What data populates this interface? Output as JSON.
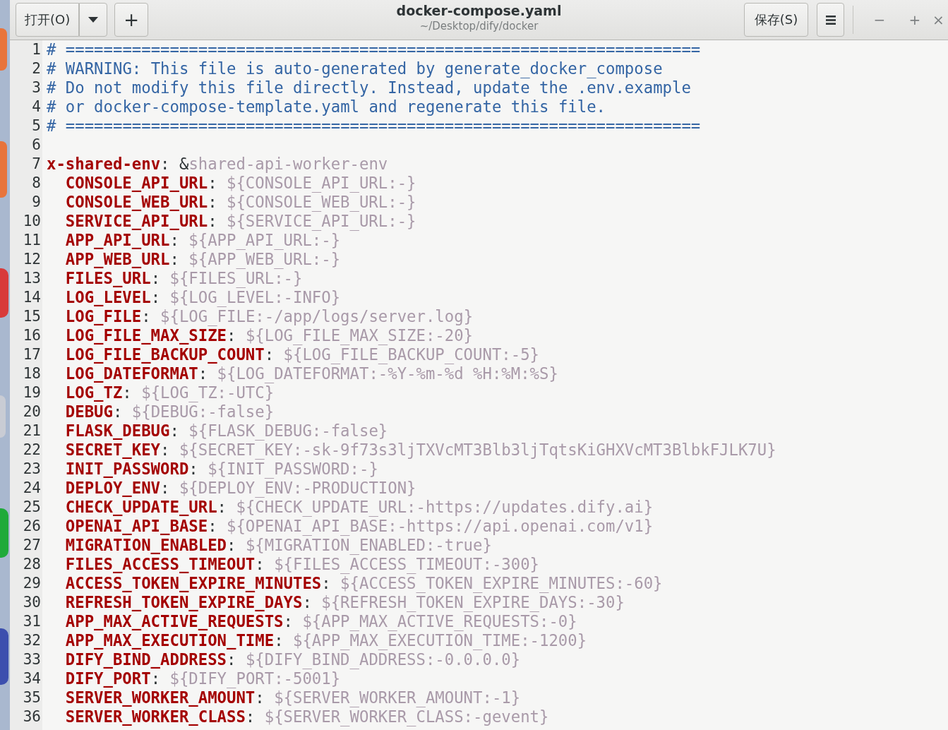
{
  "window": {
    "title": "docker-compose.yaml",
    "subtitle": "~/Desktop/dify/docker",
    "open_button": "打开(O)",
    "new_tab_button": "+",
    "save_button": "保存(S)",
    "controls": [
      "−",
      "+",
      "×"
    ]
  },
  "editor": {
    "lines": [
      {
        "number": "1",
        "indented": false,
        "segments": [
          {
            "kind": "comment",
            "text": "# ==================================================================="
          }
        ]
      },
      {
        "number": "2",
        "indented": false,
        "segments": [
          {
            "kind": "comment",
            "text": "# WARNING: This file is auto-generated by generate_docker_compose"
          }
        ]
      },
      {
        "number": "3",
        "indented": false,
        "segments": [
          {
            "kind": "comment",
            "text": "# Do not modify this file directly. Instead, update the .env.example"
          }
        ]
      },
      {
        "number": "4",
        "indented": false,
        "segments": [
          {
            "kind": "comment",
            "text": "# or docker-compose-template.yaml and regenerate this file."
          }
        ]
      },
      {
        "number": "5",
        "indented": false,
        "segments": [
          {
            "kind": "comment",
            "text": "# ==================================================================="
          }
        ]
      },
      {
        "number": "6"
      },
      {
        "number": "7",
        "indented": false,
        "segments": [
          {
            "kind": "key",
            "text": "x-shared-env"
          },
          {
            "kind": "punct",
            "text": ": &"
          },
          {
            "kind": "value",
            "text": "shared-api-worker-env"
          }
        ]
      },
      {
        "number": "8",
        "indented": true,
        "segments": [
          {
            "kind": "key",
            "text": "CONSOLE_API_URL"
          },
          {
            "kind": "punct",
            "text": ": "
          },
          {
            "kind": "value",
            "text": "${CONSOLE_API_URL:-}"
          }
        ]
      },
      {
        "number": "9",
        "indented": true,
        "segments": [
          {
            "kind": "key",
            "text": "CONSOLE_WEB_URL"
          },
          {
            "kind": "punct",
            "text": ": "
          },
          {
            "kind": "value",
            "text": "${CONSOLE_WEB_URL:-}"
          }
        ]
      },
      {
        "number": "10",
        "indented": true,
        "segments": [
          {
            "kind": "key",
            "text": "SERVICE_API_URL"
          },
          {
            "kind": "punct",
            "text": ": "
          },
          {
            "kind": "value",
            "text": "${SERVICE_API_URL:-}"
          }
        ]
      },
      {
        "number": "11",
        "indented": true,
        "segments": [
          {
            "kind": "key",
            "text": "APP_API_URL"
          },
          {
            "kind": "punct",
            "text": ": "
          },
          {
            "kind": "value",
            "text": "${APP_API_URL:-}"
          }
        ]
      },
      {
        "number": "12",
        "indented": true,
        "segments": [
          {
            "kind": "key",
            "text": "APP_WEB_URL"
          },
          {
            "kind": "punct",
            "text": ": "
          },
          {
            "kind": "value",
            "text": "${APP_WEB_URL:-}"
          }
        ]
      },
      {
        "number": "13",
        "indented": true,
        "segments": [
          {
            "kind": "key",
            "text": "FILES_URL"
          },
          {
            "kind": "punct",
            "text": ": "
          },
          {
            "kind": "value",
            "text": "${FILES_URL:-}"
          }
        ]
      },
      {
        "number": "14",
        "indented": true,
        "segments": [
          {
            "kind": "key",
            "text": "LOG_LEVEL"
          },
          {
            "kind": "punct",
            "text": ": "
          },
          {
            "kind": "value",
            "text": "${LOG_LEVEL:-INFO}"
          }
        ]
      },
      {
        "number": "15",
        "indented": true,
        "segments": [
          {
            "kind": "key",
            "text": "LOG_FILE"
          },
          {
            "kind": "punct",
            "text": ": "
          },
          {
            "kind": "value",
            "text": "${LOG_FILE:-/app/logs/server.log}"
          }
        ]
      },
      {
        "number": "16",
        "indented": true,
        "segments": [
          {
            "kind": "key",
            "text": "LOG_FILE_MAX_SIZE"
          },
          {
            "kind": "punct",
            "text": ": "
          },
          {
            "kind": "value",
            "text": "${LOG_FILE_MAX_SIZE:-20}"
          }
        ]
      },
      {
        "number": "17",
        "indented": true,
        "segments": [
          {
            "kind": "key",
            "text": "LOG_FILE_BACKUP_COUNT"
          },
          {
            "kind": "punct",
            "text": ": "
          },
          {
            "kind": "value",
            "text": "${LOG_FILE_BACKUP_COUNT:-5}"
          }
        ]
      },
      {
        "number": "18",
        "indented": true,
        "segments": [
          {
            "kind": "key",
            "text": "LOG_DATEFORMAT"
          },
          {
            "kind": "punct",
            "text": ": "
          },
          {
            "kind": "value",
            "text": "${LOG_DATEFORMAT:-%Y-%m-%d %H:%M:%S}"
          }
        ]
      },
      {
        "number": "19",
        "indented": true,
        "segments": [
          {
            "kind": "key",
            "text": "LOG_TZ"
          },
          {
            "kind": "punct",
            "text": ": "
          },
          {
            "kind": "value",
            "text": "${LOG_TZ:-UTC}"
          }
        ]
      },
      {
        "number": "20",
        "indented": true,
        "segments": [
          {
            "kind": "key",
            "text": "DEBUG"
          },
          {
            "kind": "punct",
            "text": ": "
          },
          {
            "kind": "value",
            "text": "${DEBUG:-false}"
          }
        ]
      },
      {
        "number": "21",
        "indented": true,
        "segments": [
          {
            "kind": "key",
            "text": "FLASK_DEBUG"
          },
          {
            "kind": "punct",
            "text": ": "
          },
          {
            "kind": "value",
            "text": "${FLASK_DEBUG:-false}"
          }
        ]
      },
      {
        "number": "22",
        "indented": true,
        "segments": [
          {
            "kind": "key",
            "text": "SECRET_KEY"
          },
          {
            "kind": "punct",
            "text": ": "
          },
          {
            "kind": "value",
            "text": "${SECRET_KEY:-sk-9f73s3ljTXVcMT3Blb3ljTqtsKiGHXVcMT3BlbkFJLK7U}"
          }
        ]
      },
      {
        "number": "23",
        "indented": true,
        "segments": [
          {
            "kind": "key",
            "text": "INIT_PASSWORD"
          },
          {
            "kind": "punct",
            "text": ": "
          },
          {
            "kind": "value",
            "text": "${INIT_PASSWORD:-}"
          }
        ]
      },
      {
        "number": "24",
        "indented": true,
        "segments": [
          {
            "kind": "key",
            "text": "DEPLOY_ENV"
          },
          {
            "kind": "punct",
            "text": ": "
          },
          {
            "kind": "value",
            "text": "${DEPLOY_ENV:-PRODUCTION}"
          }
        ]
      },
      {
        "number": "25",
        "indented": true,
        "segments": [
          {
            "kind": "key",
            "text": "CHECK_UPDATE_URL"
          },
          {
            "kind": "punct",
            "text": ": "
          },
          {
            "kind": "value",
            "text": "${CHECK_UPDATE_URL:-https://updates.dify.ai}"
          }
        ]
      },
      {
        "number": "26",
        "indented": true,
        "segments": [
          {
            "kind": "key",
            "text": "OPENAI_API_BASE"
          },
          {
            "kind": "punct",
            "text": ": "
          },
          {
            "kind": "value",
            "text": "${OPENAI_API_BASE:-https://api.openai.com/v1}"
          }
        ]
      },
      {
        "number": "27",
        "indented": true,
        "segments": [
          {
            "kind": "key",
            "text": "MIGRATION_ENABLED"
          },
          {
            "kind": "punct",
            "text": ": "
          },
          {
            "kind": "value",
            "text": "${MIGRATION_ENABLED:-true}"
          }
        ]
      },
      {
        "number": "28",
        "indented": true,
        "segments": [
          {
            "kind": "key",
            "text": "FILES_ACCESS_TIMEOUT"
          },
          {
            "kind": "punct",
            "text": ": "
          },
          {
            "kind": "value",
            "text": "${FILES_ACCESS_TIMEOUT:-300}"
          }
        ]
      },
      {
        "number": "29",
        "indented": true,
        "segments": [
          {
            "kind": "key",
            "text": "ACCESS_TOKEN_EXPIRE_MINUTES"
          },
          {
            "kind": "punct",
            "text": ": "
          },
          {
            "kind": "value",
            "text": "${ACCESS_TOKEN_EXPIRE_MINUTES:-60}"
          }
        ]
      },
      {
        "number": "30",
        "indented": true,
        "segments": [
          {
            "kind": "key",
            "text": "REFRESH_TOKEN_EXPIRE_DAYS"
          },
          {
            "kind": "punct",
            "text": ": "
          },
          {
            "kind": "value",
            "text": "${REFRESH_TOKEN_EXPIRE_DAYS:-30}"
          }
        ]
      },
      {
        "number": "31",
        "indented": true,
        "segments": [
          {
            "kind": "key",
            "text": "APP_MAX_ACTIVE_REQUESTS"
          },
          {
            "kind": "punct",
            "text": ": "
          },
          {
            "kind": "value",
            "text": "${APP_MAX_ACTIVE_REQUESTS:-0}"
          }
        ]
      },
      {
        "number": "32",
        "indented": true,
        "segments": [
          {
            "kind": "key",
            "text": "APP_MAX_EXECUTION_TIME"
          },
          {
            "kind": "punct",
            "text": ": "
          },
          {
            "kind": "value",
            "text": "${APP_MAX_EXECUTION_TIME:-1200}"
          }
        ]
      },
      {
        "number": "33",
        "indented": true,
        "segments": [
          {
            "kind": "key",
            "text": "DIFY_BIND_ADDRESS"
          },
          {
            "kind": "punct",
            "text": ": "
          },
          {
            "kind": "value",
            "text": "${DIFY_BIND_ADDRESS:-0.0.0.0}"
          }
        ]
      },
      {
        "number": "34",
        "indented": true,
        "segments": [
          {
            "kind": "key",
            "text": "DIFY_PORT"
          },
          {
            "kind": "punct",
            "text": ": "
          },
          {
            "kind": "value",
            "text": "${DIFY_PORT:-5001}"
          }
        ]
      },
      {
        "number": "35",
        "indented": true,
        "segments": [
          {
            "kind": "key",
            "text": "SERVER_WORKER_AMOUNT"
          },
          {
            "kind": "punct",
            "text": ": "
          },
          {
            "kind": "value",
            "text": "${SERVER_WORKER_AMOUNT:-1}"
          }
        ]
      },
      {
        "number": "36",
        "indented": true,
        "segments": [
          {
            "kind": "key",
            "text": "SERVER_WORKER_CLASS"
          },
          {
            "kind": "punct",
            "text": ": "
          },
          {
            "kind": "value",
            "text": "${SERVER_WORKER_CLASS:-gevent}"
          }
        ]
      }
    ]
  }
}
